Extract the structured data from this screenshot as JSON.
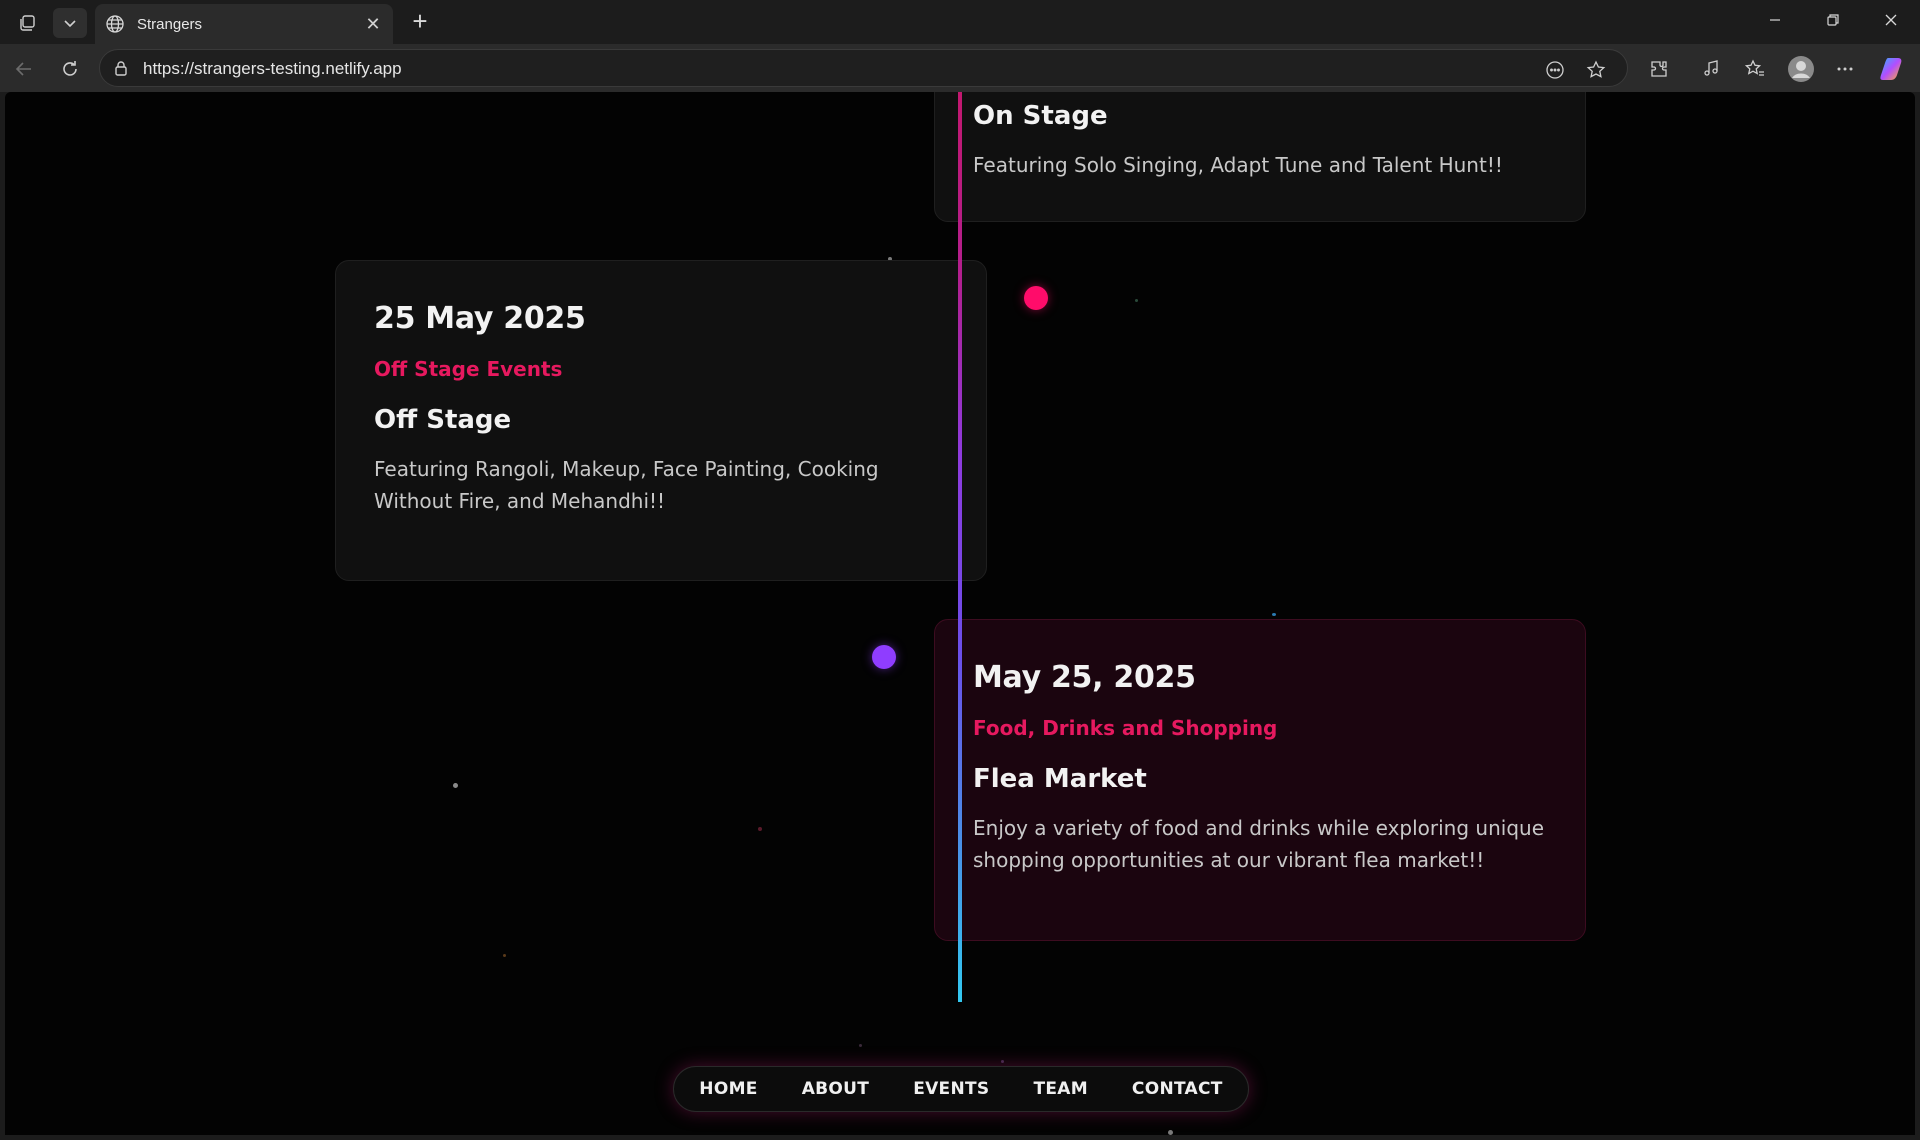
{
  "browser": {
    "tab_title": "Strangers",
    "url": "https://strangers-testing.netlify.app"
  },
  "timeline": {
    "events": [
      {
        "title": "On Stage",
        "description": "Featuring Solo Singing, Adapt Tune and Talent Hunt!!"
      },
      {
        "date": "25 May 2025",
        "category": "Off Stage Events",
        "title": "Off Stage",
        "description": "Featuring Rangoli, Makeup, Face Painting, Cooking Without Fire, and Mehandhi!!"
      },
      {
        "date": "May 25, 2025",
        "category": "Food, Drinks and Shopping",
        "title": "Flea Market",
        "description": "Enjoy a variety of food and drinks while exploring unique shopping opportunities at our vibrant flea market!!"
      }
    ]
  },
  "bottom_nav": {
    "items": [
      "HOME",
      "ABOUT",
      "EVENTS",
      "TEAM",
      "CONTACT"
    ]
  },
  "colors": {
    "accent_pink": "#ff0c6a",
    "accent_purple": "#8f3dff",
    "category_text": "#e6195f",
    "timeline_top": "#c2186f",
    "timeline_bottom": "#33c8f0"
  }
}
